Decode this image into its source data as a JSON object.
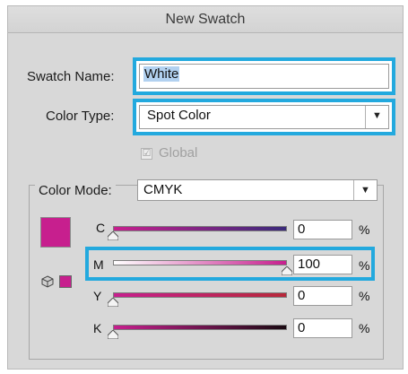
{
  "dialog": {
    "title": "New Swatch"
  },
  "swatch_name": {
    "label": "Swatch Name:",
    "value": "White"
  },
  "color_type": {
    "label": "Color Type:",
    "selected": "Spot Color",
    "arrow": "▼"
  },
  "global": {
    "label": "Global",
    "checked": true,
    "check_glyph": "☑"
  },
  "color_mode": {
    "label": "Color Mode:",
    "selected": "CMYK",
    "arrow": "▼"
  },
  "preview": {
    "color": "#c71f8e",
    "icon": "cube-icon"
  },
  "channels": [
    {
      "label": "C",
      "value": "0",
      "pct": "%",
      "level": 0
    },
    {
      "label": "M",
      "value": "100",
      "pct": "%",
      "level": 1
    },
    {
      "label": "Y",
      "value": "0",
      "pct": "%",
      "level": 0
    },
    {
      "label": "K",
      "value": "0",
      "pct": "%",
      "level": 0
    }
  ],
  "colors": {
    "highlight": "#23a9de",
    "swatch": "#c71f8e"
  }
}
